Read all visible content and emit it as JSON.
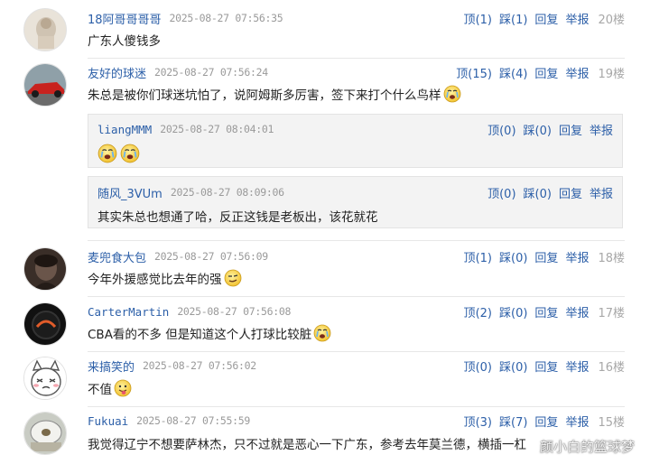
{
  "labels": {
    "up": "顶",
    "down": "踩",
    "reply": "回复",
    "report": "举报"
  },
  "comments": [
    {
      "user": "18阿哥哥哥哥",
      "time": "2025-08-27 07:56:35",
      "up": "(1)",
      "down": "(1)",
      "floor": "20楼",
      "text": "广东人傻钱多"
    },
    {
      "user": "友好的球迷",
      "time": "2025-08-27 07:56:24",
      "up": "(15)",
      "down": "(4)",
      "floor": "19楼",
      "text": "朱总是被你们球迷坑怕了，说阿姆斯多厉害，签下来打个什么鸟样",
      "replies": [
        {
          "user": "liangMMM",
          "time": "2025-08-27 08:04:01",
          "up": "(0)",
          "down": "(0)",
          "text": ""
        },
        {
          "user": "随风_3VUm",
          "time": "2025-08-27 08:09:06",
          "up": "(0)",
          "down": "(0)",
          "text": "其实朱总也想通了哈，反正这钱是老板出，该花就花"
        }
      ]
    },
    {
      "user": "麦兜食大包",
      "time": "2025-08-27 07:56:09",
      "up": "(1)",
      "down": "(0)",
      "floor": "18楼",
      "text": "今年外援感觉比去年的强"
    },
    {
      "user": "CarterMartin",
      "time": "2025-08-27 07:56:08",
      "up": "(2)",
      "down": "(0)",
      "floor": "17楼",
      "text": "CBA看的不多 但是知道这个人打球比较脏"
    },
    {
      "user": "来搞笑的",
      "time": "2025-08-27 07:56:02",
      "up": "(0)",
      "down": "(0)",
      "floor": "16楼",
      "text": "不值"
    },
    {
      "user": "Fukuai",
      "time": "2025-08-27 07:55:59",
      "up": "(3)",
      "down": "(7)",
      "floor": "15楼",
      "text": "我觉得辽宁不想要萨林杰，只不过就是恶心一下广东，参考去年莫兰德，横插一杠"
    }
  ],
  "watermark": "颜小白的篮球梦"
}
